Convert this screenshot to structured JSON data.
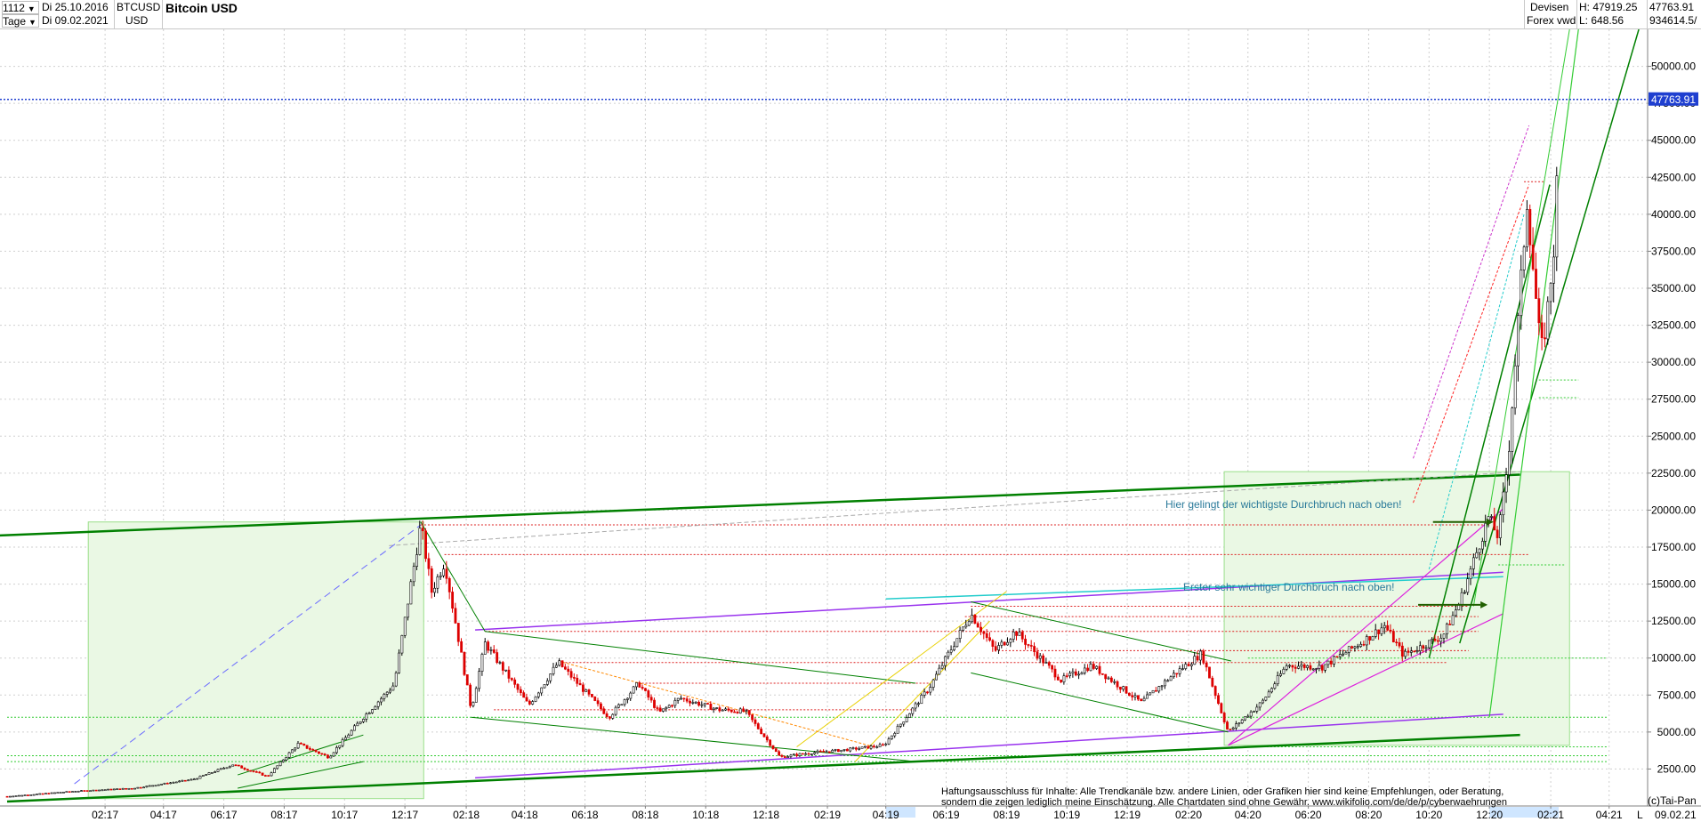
{
  "header": {
    "period_value": "1112",
    "interval_value": "Tage",
    "date_from": "Di 25.10.2016",
    "date_to": "Di 09.02.2021",
    "symbol": "BTCUSD",
    "currency": "USD",
    "title": "Bitcoin USD",
    "market_line1": "Devisen",
    "market_line2": "Forex vwd",
    "high_label": "H: 47919.25",
    "low_label": "L: 648.56",
    "last_value": "47763.91",
    "volume_value": "934614.5/"
  },
  "price_marker": "47763.91",
  "annotations": {
    "breakout_main": "Hier gelingt der wichtigste Durchbruch nach oben!",
    "breakout_first": "Erster sehr wichtiger Durchbruch nach oben!"
  },
  "disclaimer": {
    "line1": "Haftungsausschluss für Inhalte: Alle Trendkanäle bzw. andere Linien, oder Grafiken hier sind keine Empfehlungen, oder Beratung,",
    "line2": "sondern die zeigen lediglich meine  Einschätzung. Alle Chartdaten sind ohne Gewähr.  www.wikifolio.com/de/de/p/cyberwaehrungen"
  },
  "footer": {
    "copyright": "(c)Tai-Pan",
    "last_date": "09.02.21",
    "mode_label": "L"
  },
  "colors": {
    "up_candle": "#000000",
    "down_candle": "#dd0000",
    "trend_main": "#008000",
    "channel_purple": "#9933ee",
    "channel_magenta": "#dd22dd",
    "channel_cyan": "#22cccc",
    "marker_blue": "#1f3fd0",
    "box_fill": "#eaf8e4"
  },
  "chart_data": {
    "type": "candlestick",
    "title": "Bitcoin USD",
    "symbol": "BTCUSD",
    "x_tick_labels": [
      "02:17",
      "04:17",
      "06:17",
      "08:17",
      "10:17",
      "12:17",
      "02:18",
      "04:18",
      "06:18",
      "08:18",
      "10:18",
      "12:18",
      "02:19",
      "04:19",
      "06:19",
      "08:19",
      "10:19",
      "12:19",
      "02:20",
      "04:20",
      "06:20",
      "08:20",
      "10:20",
      "12:20",
      "02:21",
      "04:21"
    ],
    "x_tick_months": [
      "2017-02",
      "2017-04",
      "2017-06",
      "2017-08",
      "2017-10",
      "2017-12",
      "2018-02",
      "2018-04",
      "2018-06",
      "2018-08",
      "2018-10",
      "2018-12",
      "2019-02",
      "2019-04",
      "2019-06",
      "2019-08",
      "2019-10",
      "2019-12",
      "2020-02",
      "2020-04",
      "2020-06",
      "2020-08",
      "2020-10",
      "2020-12",
      "2021-02",
      "2021-04"
    ],
    "y_ticks": [
      "2500.00",
      "5000.00",
      "7500.00",
      "10000.00",
      "12500.00",
      "15000.00",
      "17500.00",
      "20000.00",
      "22500.00",
      "25000.00",
      "27500.00",
      "30000.00",
      "32500.00",
      "35000.00",
      "37500.00",
      "40000.00",
      "42500.00",
      "45000.00",
      "47500.00",
      "50000.00"
    ],
    "ylim": [
      0,
      52500
    ],
    "log_scale": false,
    "grid": true,
    "start_date": "2016-10-25",
    "end_date": "2021-02-09",
    "high": 47919.25,
    "low": 648.56,
    "last": 47763.91,
    "price_path": [
      [
        "2016-10-25",
        650
      ],
      [
        "2017-01-01",
        1000
      ],
      [
        "2017-03-01",
        1200
      ],
      [
        "2017-05-01",
        1800
      ],
      [
        "2017-06-10",
        2800
      ],
      [
        "2017-07-15",
        2000
      ],
      [
        "2017-08-15",
        4200
      ],
      [
        "2017-09-15",
        3300
      ],
      [
        "2017-10-20",
        6000
      ],
      [
        "2017-11-20",
        8200
      ],
      [
        "2017-12-17",
        19000
      ],
      [
        "2017-12-28",
        14500
      ],
      [
        "2018-01-10",
        16500
      ],
      [
        "2018-02-06",
        6500
      ],
      [
        "2018-02-20",
        11000
      ],
      [
        "2018-04-05",
        6800
      ],
      [
        "2018-05-05",
        9700
      ],
      [
        "2018-06-25",
        6000
      ],
      [
        "2018-07-25",
        8300
      ],
      [
        "2018-08-15",
        6300
      ],
      [
        "2018-09-05",
        7300
      ],
      [
        "2018-10-15",
        6500
      ],
      [
        "2018-11-10",
        6400
      ],
      [
        "2018-12-15",
        3300
      ],
      [
        "2019-01-15",
        3600
      ],
      [
        "2019-02-20",
        3800
      ],
      [
        "2019-03-30",
        4100
      ],
      [
        "2019-05-15",
        8000
      ],
      [
        "2019-06-26",
        13000
      ],
      [
        "2019-07-20",
        10500
      ],
      [
        "2019-08-10",
        11800
      ],
      [
        "2019-09-25",
        8500
      ],
      [
        "2019-10-26",
        9500
      ],
      [
        "2019-12-15",
        7000
      ],
      [
        "2020-01-15",
        8800
      ],
      [
        "2020-02-14",
        10300
      ],
      [
        "2020-03-12",
        5000
      ],
      [
        "2020-04-15",
        7000
      ],
      [
        "2020-05-10",
        9500
      ],
      [
        "2020-06-15",
        9400
      ],
      [
        "2020-07-28",
        11200
      ],
      [
        "2020-08-17",
        12200
      ],
      [
        "2020-09-05",
        10200
      ],
      [
        "2020-10-15",
        11500
      ],
      [
        "2020-11-01",
        13800
      ],
      [
        "2020-11-30",
        19500
      ],
      [
        "2020-12-10",
        18200
      ],
      [
        "2020-12-20",
        23500
      ],
      [
        "2021-01-08",
        41000
      ],
      [
        "2021-01-22",
        30500
      ],
      [
        "2021-01-28",
        33000
      ],
      [
        "2021-02-06",
        39000
      ],
      [
        "2021-02-09",
        47763.91
      ]
    ],
    "annotations": [
      {
        "text": "Hier gelingt der wichtigste Durchbruch nach oben!",
        "date": "2020-06-25",
        "price": 19200
      },
      {
        "text": "Erster sehr wichtiger Durchbruch nach oben!",
        "date": "2020-04-15",
        "price": 13600
      }
    ]
  }
}
